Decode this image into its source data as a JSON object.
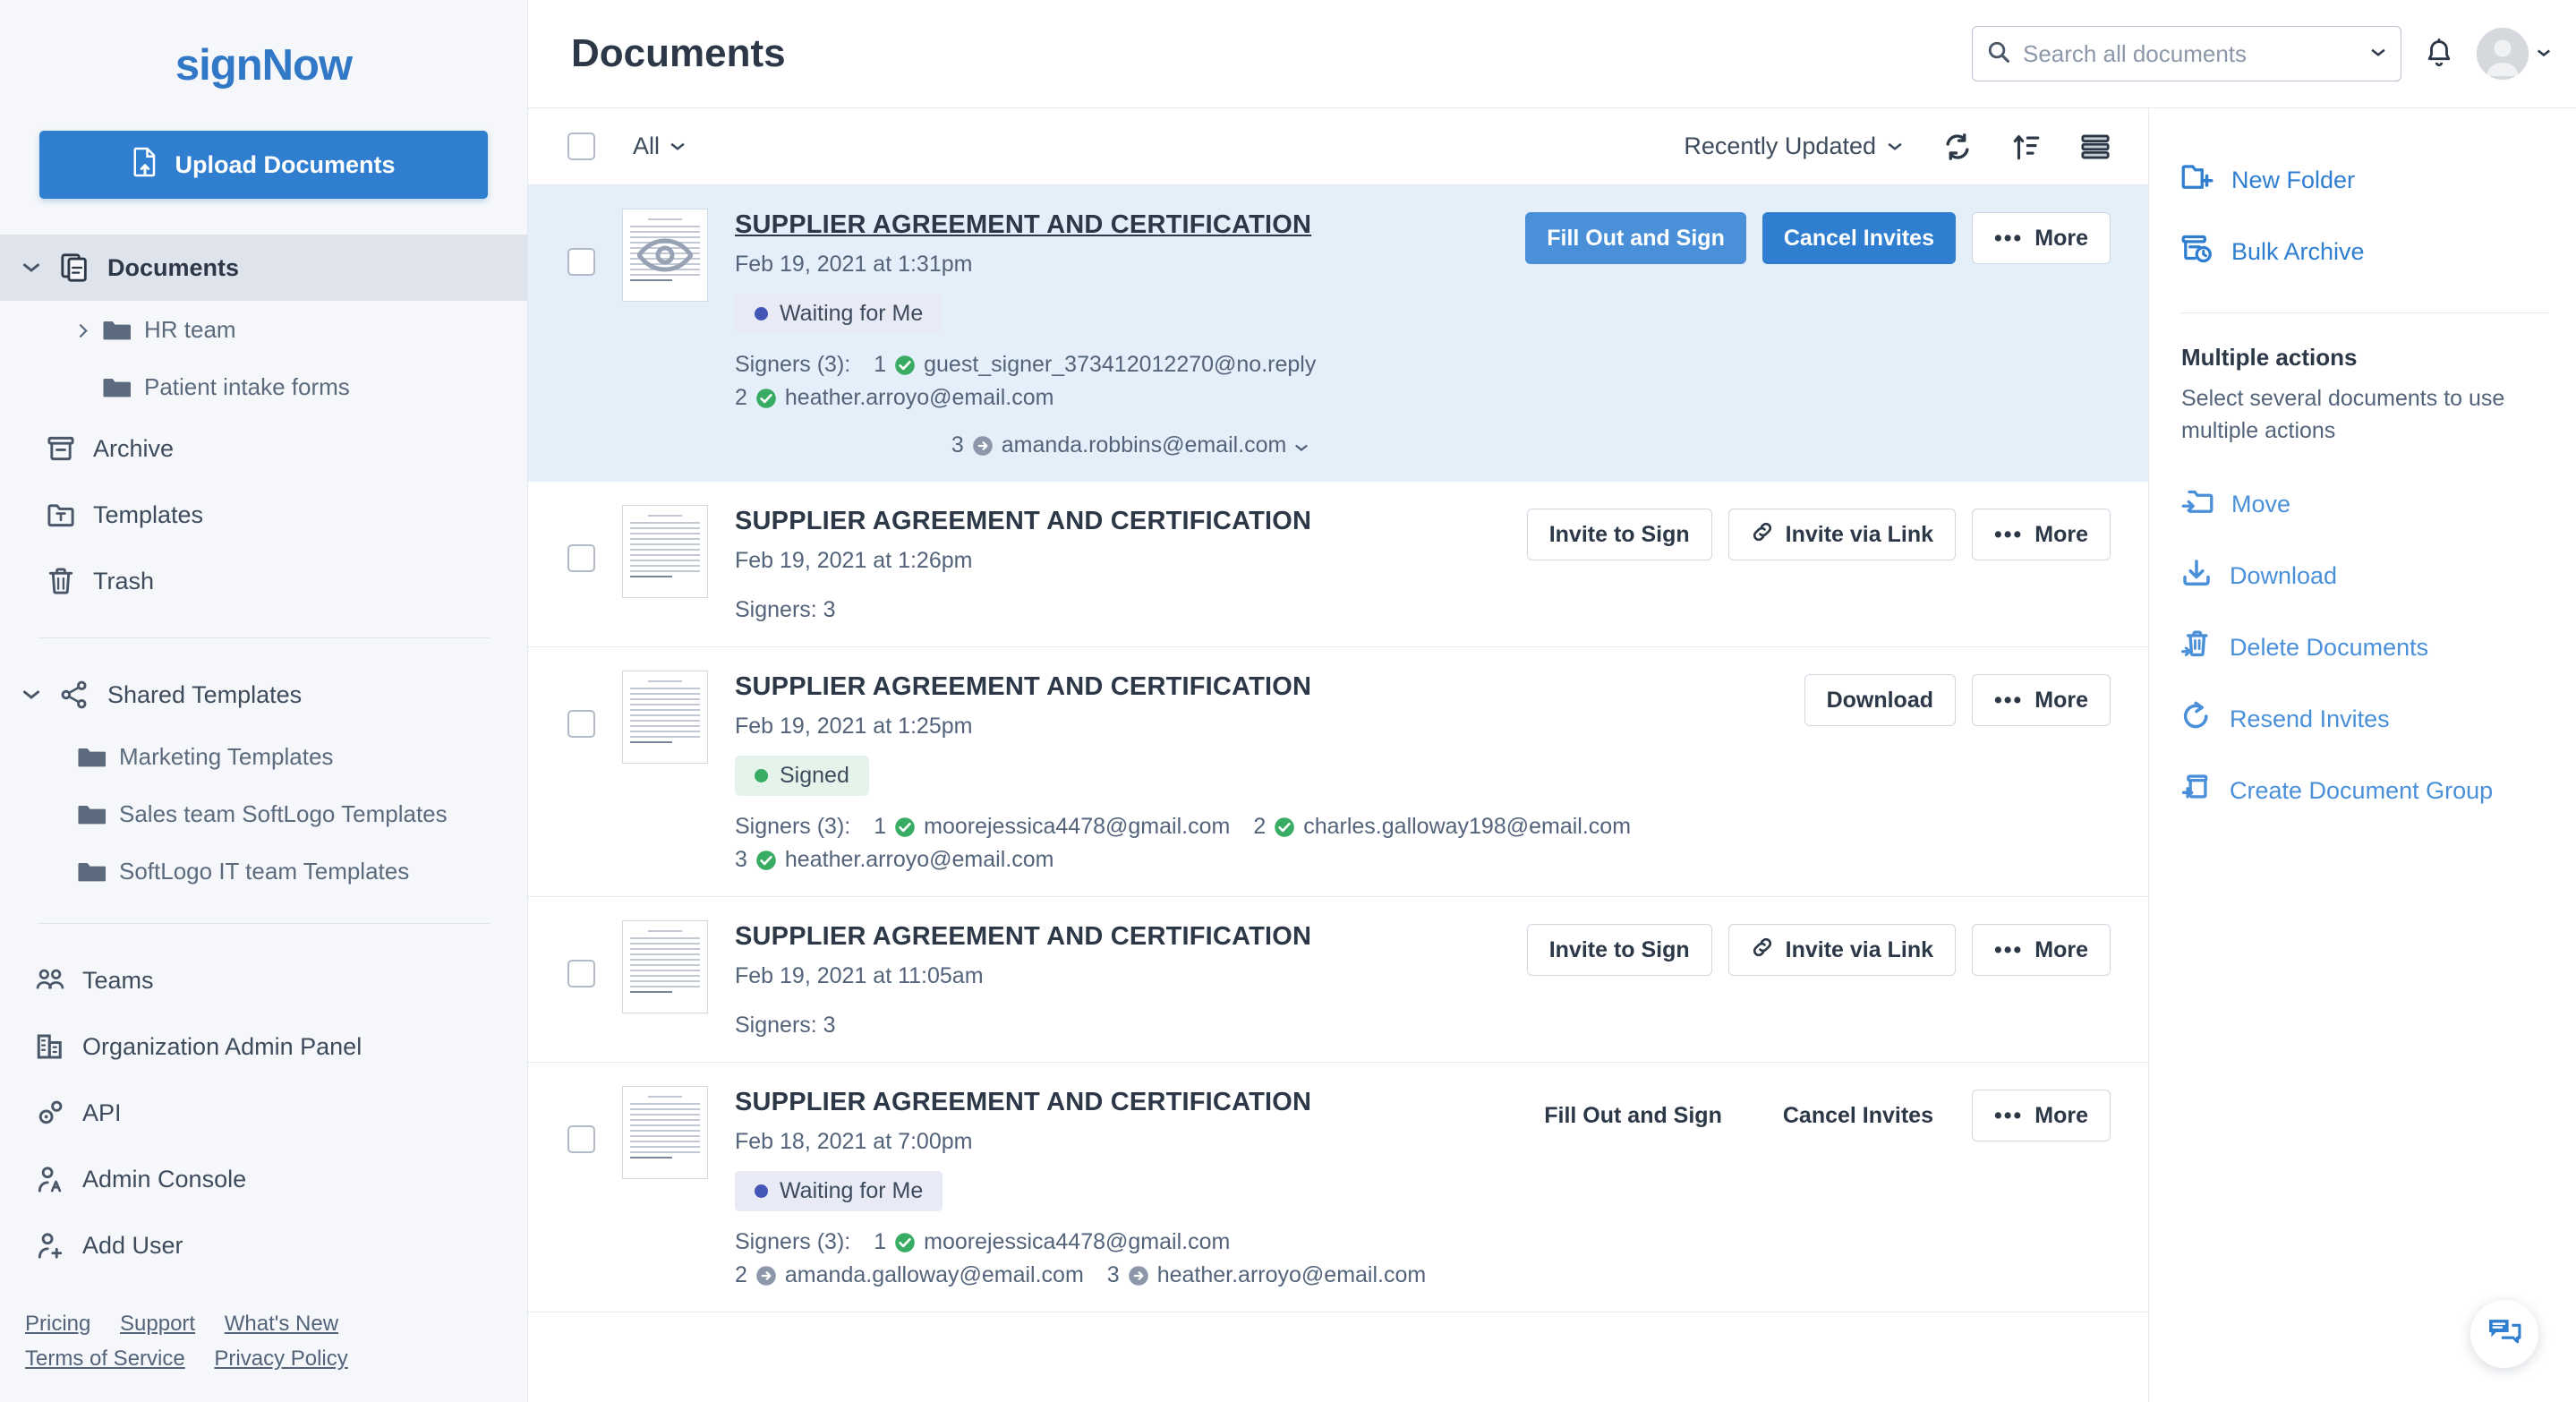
{
  "brand": {
    "logo_text": "signNow",
    "accent_color": "#2f7ed0",
    "accent_light": "#4a90d9"
  },
  "sidebar": {
    "upload_button": "Upload Documents",
    "nav": [
      {
        "label": "Documents",
        "icon": "documents-icon",
        "active": true,
        "expandable": true
      },
      {
        "label": "HR team",
        "icon": "folder-icon",
        "sub": true,
        "expandable": true
      },
      {
        "label": "Patient intake forms",
        "icon": "folder-icon",
        "sub": true
      },
      {
        "label": "Archive",
        "icon": "archive-icon"
      },
      {
        "label": "Templates",
        "icon": "templates-icon"
      },
      {
        "label": "Trash",
        "icon": "trash-icon"
      }
    ],
    "shared": {
      "label": "Shared Templates",
      "items": [
        {
          "label": "Marketing Templates"
        },
        {
          "label": "Sales team SoftLogo Templates"
        },
        {
          "label": "SoftLogo IT team Templates"
        }
      ]
    },
    "admin_nav": [
      {
        "label": "Teams",
        "icon": "teams-icon"
      },
      {
        "label": "Organization Admin Panel",
        "icon": "organization-icon"
      },
      {
        "label": "API",
        "icon": "api-gear-icon"
      },
      {
        "label": "Admin Console",
        "icon": "admin-console-icon"
      },
      {
        "label": "Add User",
        "icon": "add-user-icon"
      }
    ],
    "footer_links": [
      "Pricing",
      "Support",
      "What's New",
      "Terms of Service",
      "Privacy Policy"
    ]
  },
  "header": {
    "title": "Documents",
    "search_placeholder": "Search all documents",
    "search_value": ""
  },
  "toolbar": {
    "filter_label": "All",
    "sort_label": "Recently Updated",
    "icons": [
      "refresh-icon",
      "sort-icon",
      "view-density-icon"
    ]
  },
  "documents": [
    {
      "title": "SUPPLIER AGREEMENT AND CERTIFICATION",
      "date": "Feb 19, 2021 at 1:31pm",
      "status": "Waiting for Me",
      "status_type": "waiting",
      "selected": true,
      "signers_label": "Signers (3):",
      "signers": [
        {
          "num": "1",
          "email": "guest_signer_373412012270@no.reply",
          "state": "signed"
        },
        {
          "num": "2",
          "email": "heather.arroyo@email.com",
          "state": "signed"
        },
        {
          "num": "3",
          "email": "amanda.robbins@email.com",
          "state": "pending",
          "has_caret": true
        }
      ],
      "signers_wrap_second_row": true,
      "actions": [
        {
          "label": "Fill Out and Sign",
          "style": "primary"
        },
        {
          "label": "Cancel Invites",
          "style": "primary-dark"
        },
        {
          "label": "More",
          "style": "outline",
          "icon": "more-dots-icon"
        }
      ]
    },
    {
      "title": "SUPPLIER AGREEMENT AND CERTIFICATION",
      "date": "Feb 19, 2021 at 1:26pm",
      "signers_plain": "Signers: 3",
      "actions": [
        {
          "label": "Invite to Sign",
          "style": "outline"
        },
        {
          "label": "Invite via Link",
          "style": "outline",
          "icon": "link-icon"
        },
        {
          "label": "More",
          "style": "outline",
          "icon": "more-dots-icon"
        }
      ]
    },
    {
      "title": "SUPPLIER AGREEMENT AND CERTIFICATION",
      "date": "Feb 19, 2021 at 1:25pm",
      "status": "Signed",
      "status_type": "signed",
      "signers_label": "Signers (3):",
      "signers": [
        {
          "num": "1",
          "email": "moorejessica4478@gmail.com",
          "state": "signed"
        },
        {
          "num": "2",
          "email": "charles.galloway198@email.com",
          "state": "signed"
        },
        {
          "num": "3",
          "email": "heather.arroyo@email.com",
          "state": "signed"
        }
      ],
      "actions": [
        {
          "label": "Download",
          "style": "outline"
        },
        {
          "label": "More",
          "style": "outline",
          "icon": "more-dots-icon"
        }
      ]
    },
    {
      "title": "SUPPLIER AGREEMENT AND CERTIFICATION",
      "date": "Feb 19, 2021 at 11:05am",
      "signers_plain": "Signers: 3",
      "actions": [
        {
          "label": "Invite to Sign",
          "style": "outline"
        },
        {
          "label": "Invite via Link",
          "style": "outline",
          "icon": "link-icon"
        },
        {
          "label": "More",
          "style": "outline",
          "icon": "more-dots-icon"
        }
      ]
    },
    {
      "title": "SUPPLIER AGREEMENT AND CERTIFICATION",
      "date": "Feb 18, 2021 at 7:00pm",
      "status": "Waiting for Me",
      "status_type": "waiting",
      "signers_label": "Signers (3):",
      "signers": [
        {
          "num": "1",
          "email": "moorejessica4478@gmail.com",
          "state": "signed"
        },
        {
          "num": "2",
          "email": "amanda.galloway@email.com",
          "state": "pending"
        },
        {
          "num": "3",
          "email": "heather.arroyo@email.com",
          "state": "pending"
        }
      ],
      "actions": [
        {
          "label": "Fill Out and Sign",
          "style": "plain"
        },
        {
          "label": "Cancel Invites",
          "style": "plain"
        },
        {
          "label": "More",
          "style": "outline",
          "icon": "more-dots-icon"
        }
      ]
    }
  ],
  "right_panel": {
    "top_items": [
      {
        "label": "New Folder",
        "icon": "new-folder-icon"
      },
      {
        "label": "Bulk Archive",
        "icon": "bulk-archive-icon"
      }
    ],
    "multiple_actions_title": "Multiple actions",
    "multiple_actions_hint": "Select several documents to use multiple actions",
    "actions": [
      {
        "label": "Move",
        "icon": "move-icon"
      },
      {
        "label": "Download",
        "icon": "download-icon"
      },
      {
        "label": "Delete Documents",
        "icon": "delete-icon"
      },
      {
        "label": "Resend Invites",
        "icon": "resend-icon"
      },
      {
        "label": "Create Document Group",
        "icon": "document-group-icon"
      }
    ]
  },
  "chat_fab": {
    "icon": "chat-bubble-icon"
  }
}
